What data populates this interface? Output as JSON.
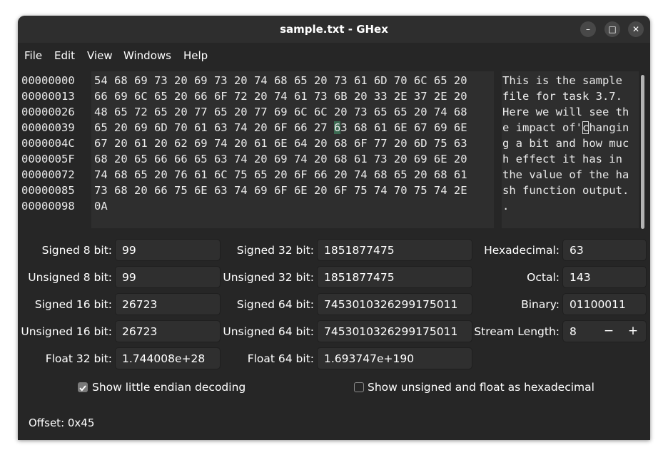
{
  "window": {
    "title": "sample.txt - GHex",
    "buttons": {
      "minimize": "–",
      "maximize": "□",
      "close": "✕"
    }
  },
  "menu": [
    "File",
    "Edit",
    "View",
    "Windows",
    "Help"
  ],
  "hex_view": {
    "offsets": [
      "00000000",
      "00000013",
      "00000026",
      "00000039",
      "0000004C",
      "0000005F",
      "00000072",
      "00000085",
      "00000098"
    ],
    "hex_rows": [
      "54 68 69 73 20 69 73 20 74 68 65 20 73 61 6D 70 6C 65 20",
      "66 69 6C 65 20 66 6F 72 20 74 61 73 6B 20 33 2E 37 2E 20",
      "48 65 72 65 20 77 65 20 77 69 6C 6C 20 73 65 65 20 74 68",
      {
        "before": "65 20 69 6D 70 61 63 74 20 6F 66 27 ",
        "sel": "6",
        "after": "3 68 61 6E 67 69 6E"
      },
      "67 20 61 20 62 69 74 20 61 6E 64 20 68 6F 77 20 6D 75 63",
      "68 20 65 66 66 65 63 74 20 69 74 20 68 61 73 20 69 6E 20",
      "74 68 65 20 76 61 6C 75 65 20 6F 66 20 74 68 65 20 68 61",
      "73 68 20 66 75 6E 63 74 69 6F 6E 20 6F 75 74 70 75 74 2E",
      "0A"
    ],
    "ascii_rows": [
      "This is the sample",
      "file for task 3.7.",
      "Here we will see th",
      {
        "before": "e impact of'",
        "sel": "c",
        "after": "hangin"
      },
      "g a bit and how muc",
      "h effect it has in",
      "the value of the ha",
      "sh function output.",
      "."
    ]
  },
  "decoding": {
    "signed_8_label": "Signed 8 bit:",
    "signed_8": "99",
    "unsigned_8_label": "Unsigned 8 bit:",
    "unsigned_8": "99",
    "signed_16_label": "Signed 16 bit:",
    "signed_16": "26723",
    "unsigned_16_label": "Unsigned 16 bit:",
    "unsigned_16": "26723",
    "float_32_label": "Float 32 bit:",
    "float_32": "1.744008e+28",
    "signed_32_label": "Signed 32 bit:",
    "signed_32": "1851877475",
    "unsigned_32_label": "Unsigned 32 bit:",
    "unsigned_32": "1851877475",
    "signed_64_label": "Signed 64 bit:",
    "signed_64": "7453010326299175011",
    "unsigned_64_label": "Unsigned 64 bit:",
    "unsigned_64": "7453010326299175011",
    "float_64_label": "Float 64 bit:",
    "float_64": "1.693747e+190",
    "hexadecimal_label": "Hexadecimal:",
    "hexadecimal": "63",
    "octal_label": "Octal:",
    "octal": "143",
    "binary_label": "Binary:",
    "binary": "01100011",
    "stream_length_label": "Stream Length:",
    "stream_length": "8",
    "stream_minus": "−",
    "stream_plus": "+"
  },
  "options": {
    "little_endian": {
      "label": "Show little endian decoding",
      "checked": true
    },
    "unsigned_float_hex": {
      "label": "Show unsigned and float as hexadecimal",
      "checked": false
    }
  },
  "status": {
    "offset": "Offset: 0x45"
  },
  "icons": {
    "checkmark": "✓"
  },
  "colors": {
    "window_bg": "#262626",
    "selection": "#3b6b52"
  }
}
